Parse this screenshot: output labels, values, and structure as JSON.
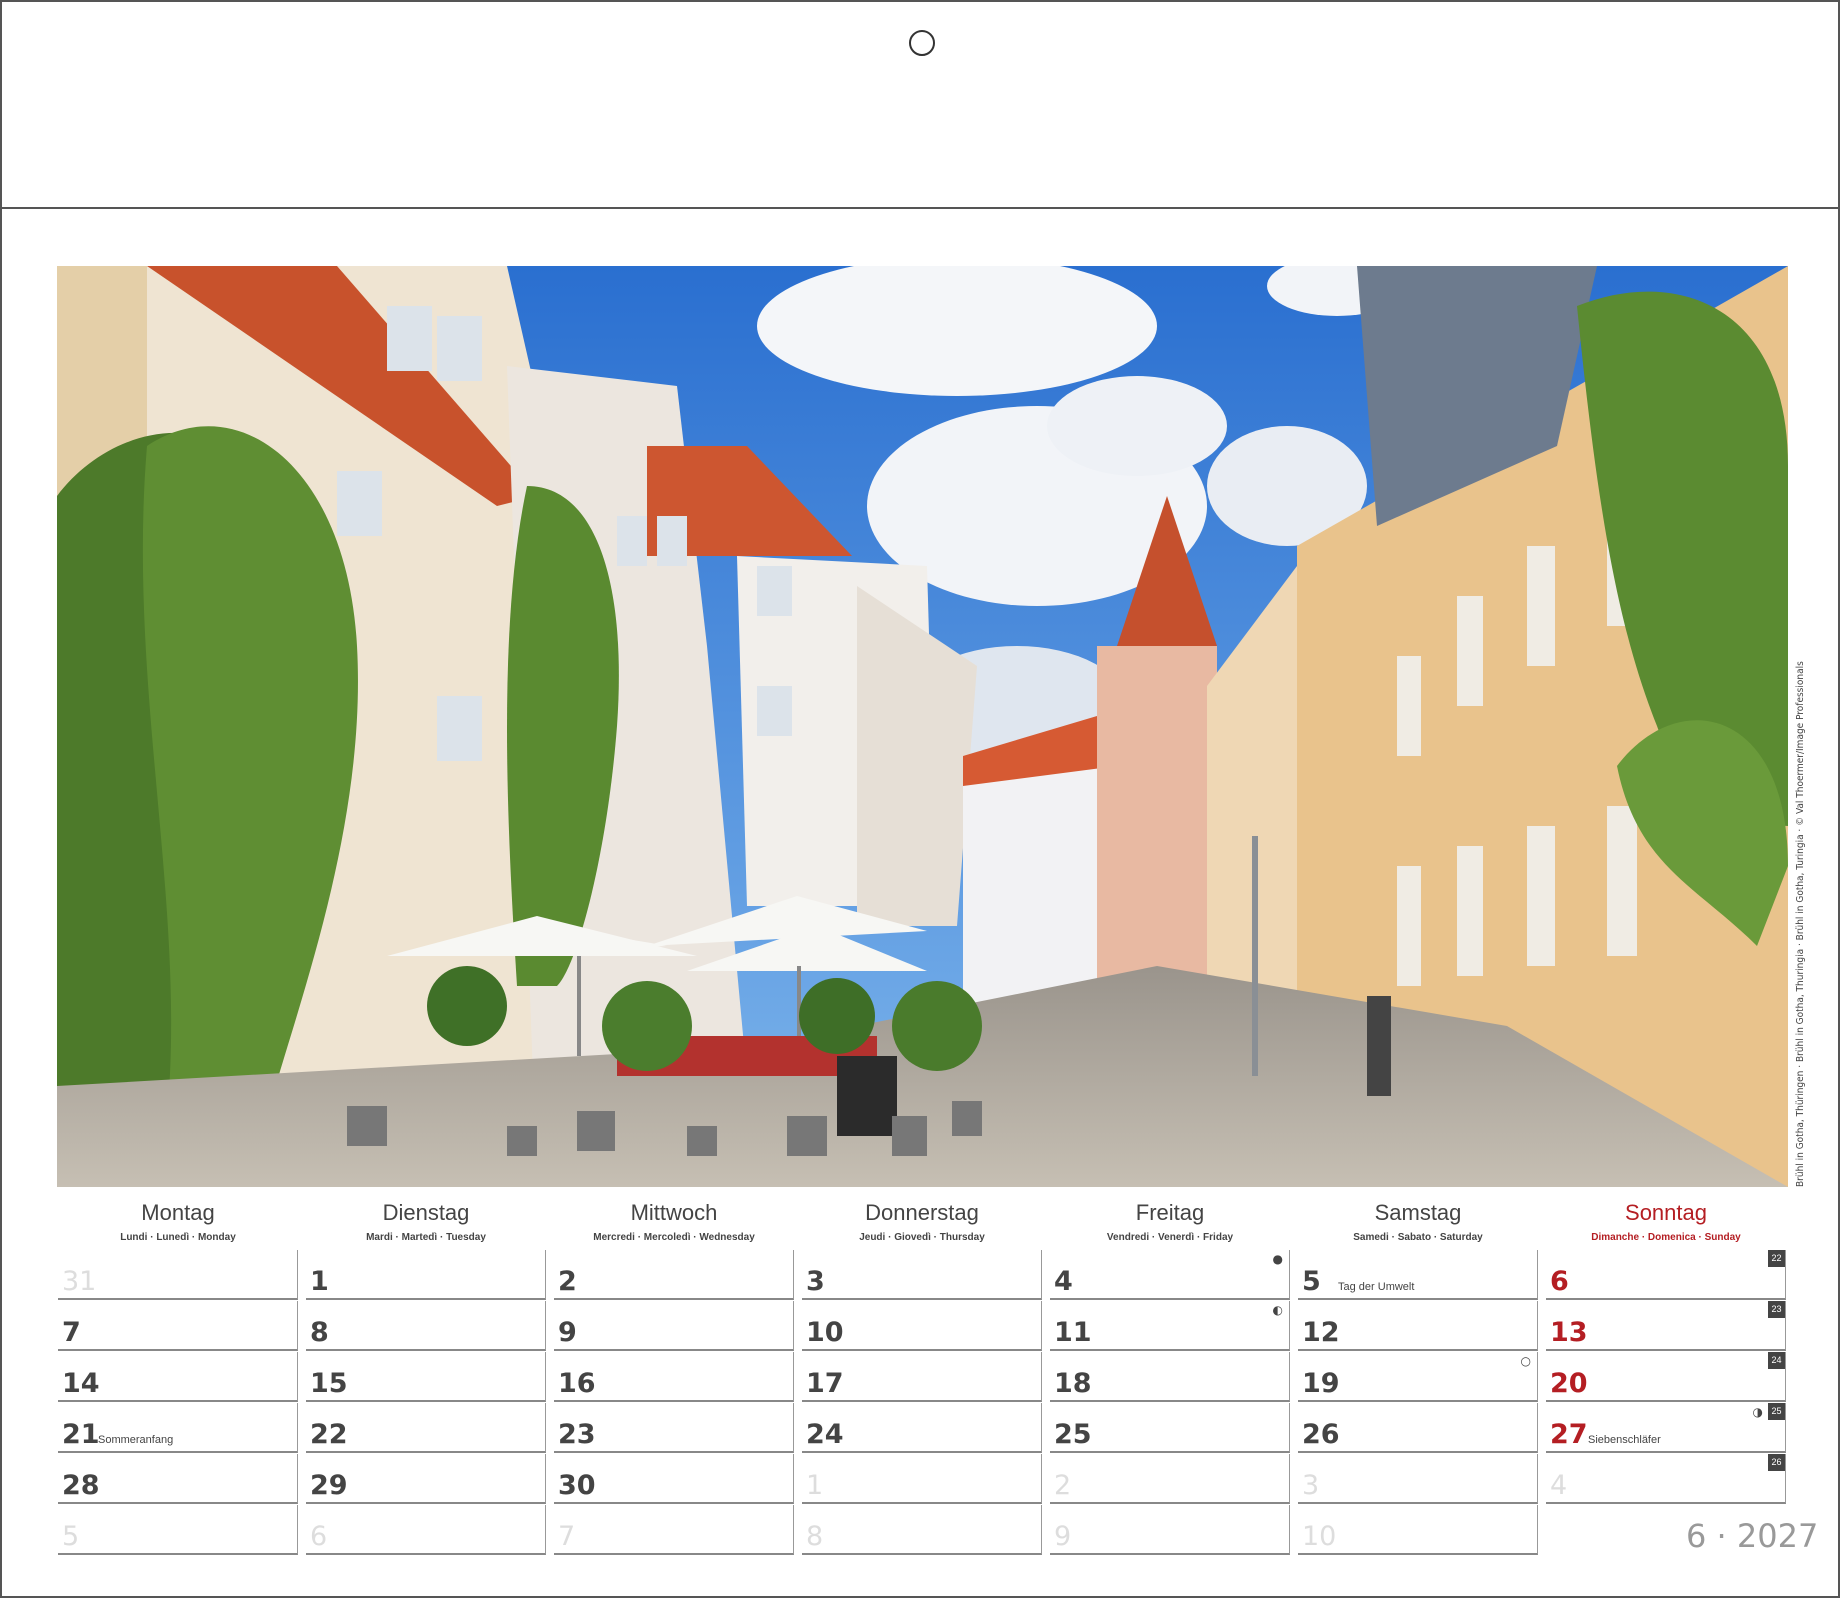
{
  "photo_credit": "Brühl in Gotha, Thüringen · Brühl in Gotha, Thuringia · Brühl in Gotha, Turingia · © Val Thoermer/Image Professionals",
  "weekdays": [
    {
      "name": "Montag",
      "sub": "Lundi · Lunedì · Monday"
    },
    {
      "name": "Dienstag",
      "sub": "Mardi · Martedì · Tuesday"
    },
    {
      "name": "Mittwoch",
      "sub": "Mercredi · Mercoledì · Wednesday"
    },
    {
      "name": "Donnerstag",
      "sub": "Jeudi · Giovedì · Thursday"
    },
    {
      "name": "Freitag",
      "sub": "Vendredi · Venerdì · Friday"
    },
    {
      "name": "Samstag",
      "sub": "Samedi · Sabato · Saturday"
    },
    {
      "name": "Sonntag",
      "sub": "Dimanche · Domenica · Sunday"
    }
  ],
  "weeks": [
    {
      "days": [
        "31",
        "1",
        "2",
        "3",
        "4",
        "5",
        "6"
      ],
      "week_number": "22"
    },
    {
      "days": [
        "7",
        "8",
        "9",
        "10",
        "11",
        "12",
        "13"
      ],
      "week_number": "23"
    },
    {
      "days": [
        "14",
        "15",
        "16",
        "17",
        "18",
        "19",
        "20"
      ],
      "week_number": "24"
    },
    {
      "days": [
        "21",
        "22",
        "23",
        "24",
        "25",
        "26",
        "27"
      ],
      "week_number": "25"
    },
    {
      "days": [
        "28",
        "29",
        "30",
        "1",
        "2",
        "3",
        "4"
      ],
      "week_number": "26"
    },
    {
      "days": [
        "5",
        "6",
        "7",
        "8",
        "9",
        "10",
        ""
      ],
      "week_number": ""
    }
  ],
  "notes": {
    "tag_der_umwelt": "Tag der Umwelt",
    "sommeranfang": "Sommeranfang",
    "siebenschlaefer": "Siebenschläfer"
  },
  "moon_phases": {
    "full": "●",
    "last_quarter": "◐",
    "new": "○",
    "first_quarter": "◑"
  },
  "month_year": "6 · 2027",
  "colors": {
    "sunday": "#b41e23",
    "text": "#444444",
    "muted": "#dddddd"
  }
}
